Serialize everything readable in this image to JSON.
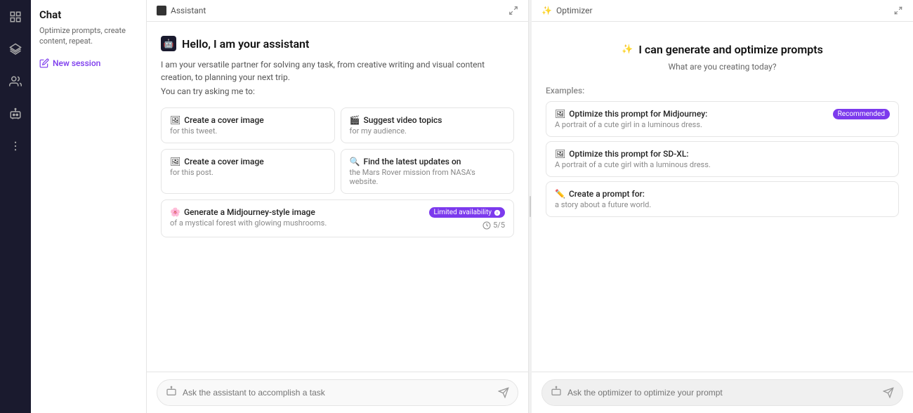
{
  "sidebar": {
    "icons": [
      "grid-icon",
      "layers-icon",
      "users-icon",
      "bot-icon",
      "more-icon"
    ]
  },
  "chat_panel": {
    "title": "Chat",
    "subtitle": "Optimize prompts, create content, repeat.",
    "new_session_label": "New session"
  },
  "assistant": {
    "header_label": "Assistant",
    "greeting": "Hello, I am your assistant",
    "greeting_icon": "🤖",
    "intro_line1": "I am your versatile partner for solving any task, from creative writing and visual content creation, to planning your next trip.",
    "intro_line2": "You can try asking me to:",
    "suggestions": [
      {
        "icon": "🖼",
        "title": "Create a cover image",
        "subtitle": "for this tweet."
      },
      {
        "icon": "🎬",
        "title": "Suggest video topics",
        "subtitle": "for my audience."
      },
      {
        "icon": "🖼",
        "title": "Create a cover image",
        "subtitle": "for this post."
      },
      {
        "icon": "🔍",
        "title": "Find the latest updates on",
        "subtitle": "the Mars Rover mission from NASA's website."
      }
    ],
    "midjourney_card": {
      "icon": "🌸",
      "title": "Generate a Midjourney-style image",
      "subtitle": "of a mystical forest with glowing mushrooms.",
      "badge_label": "Limited availability",
      "count": "5/5"
    },
    "input_placeholder": "Ask the assistant to accomplish a task"
  },
  "optimizer": {
    "header_label": "Optimizer",
    "greeting": "I can generate and optimize prompts",
    "greeting_icon": "✨",
    "question": "What are you creating today?",
    "examples_label": "Examples:",
    "examples": [
      {
        "icon": "🖼",
        "title": "Optimize this prompt for Midjourney:",
        "subtitle": "A portrait of a cute girl in a luminous dress.",
        "badge_label": "Recommended"
      },
      {
        "icon": "🖼",
        "title": "Optimize this prompt for SD-XL:",
        "subtitle": "A portrait of a cute girl with a luminous dress.",
        "badge_label": null
      },
      {
        "icon": "✏️",
        "title": "Create a prompt for:",
        "subtitle": "a story about a future world.",
        "badge_label": null
      }
    ],
    "input_placeholder": "Ask the optimizer to optimize your prompt"
  }
}
